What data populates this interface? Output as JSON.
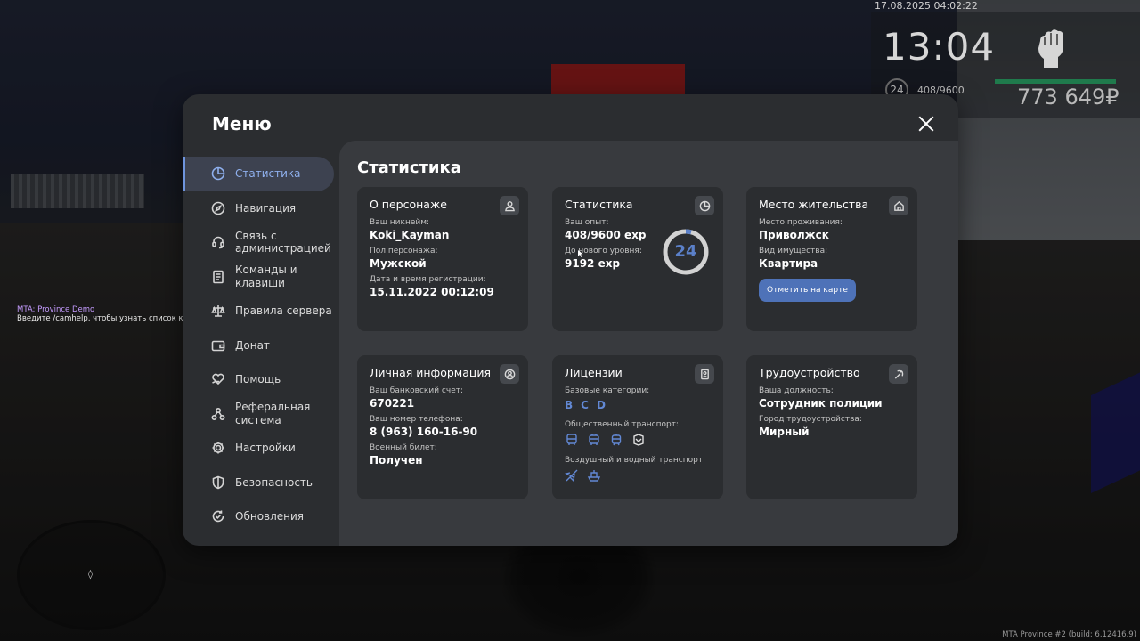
{
  "hud": {
    "datetime": "17.08.2025 04:02:22",
    "time": "13:04",
    "level": "24",
    "exp": "408/9600",
    "money": "773 649₽"
  },
  "chat": {
    "line1": "MTA: Province Demo",
    "line2": "Введите /camhelp, чтобы узнать список команд для работы с камерой."
  },
  "build_info": "MTA Province #2 (build: 6.12416.9)",
  "menu": {
    "title": "Меню",
    "sidebar": [
      {
        "label": "Статистика",
        "icon": "pie-chart-icon",
        "active": true
      },
      {
        "label": "Навигация",
        "icon": "compass-icon"
      },
      {
        "label": "Связь с администрацией",
        "icon": "headset-icon"
      },
      {
        "label": "Команды и клавиши",
        "icon": "document-icon"
      },
      {
        "label": "Правила сервера",
        "icon": "scales-icon"
      },
      {
        "label": "Донат",
        "icon": "wallet-icon"
      },
      {
        "label": "Помощь",
        "icon": "heart-hand-icon"
      },
      {
        "label": "Реферальная система",
        "icon": "network-icon"
      },
      {
        "label": "Настройки",
        "icon": "gear-icon"
      },
      {
        "label": "Безопасность",
        "icon": "shield-icon"
      },
      {
        "label": "Обновления",
        "icon": "refresh-icon"
      }
    ],
    "content_title": "Статистика",
    "cards": {
      "character": {
        "title": "О персонаже",
        "nickname_label": "Ваш никнейм:",
        "nickname": "Koki_Kayman",
        "gender_label": "Пол персонажа:",
        "gender": "Мужской",
        "reg_label": "Дата и время регистрации:",
        "reg": "15.11.2022 00:12:09"
      },
      "stats": {
        "title": "Статистика",
        "exp_label": "Ваш опыт:",
        "exp": "408/9600 exp",
        "next_label": "До нового уровня:",
        "next": "9192 exp",
        "level": "24",
        "progress": 0.0425
      },
      "residence": {
        "title": "Место жительства",
        "place_label": "Место проживания:",
        "place": "Приволжск",
        "property_label": "Вид имущества:",
        "property": "Квартира",
        "button": "Отметить на карте"
      },
      "personal": {
        "title": "Личная информация",
        "bank_label": "Ваш банковский счет:",
        "bank": "670221",
        "phone_label": "Ваш номер телефона:",
        "phone": "8 (963) 160-16-90",
        "military_label": "Военный билет:",
        "military": "Получен"
      },
      "licenses": {
        "title": "Лицензии",
        "base_label": "Базовые категории:",
        "base_categories": [
          "B",
          "C",
          "D"
        ],
        "public_label": "Общественный транспорт:",
        "air_label": "Воздушный и водный транспорт:"
      },
      "employment": {
        "title": "Трудоустройство",
        "position_label": "Ваша должность:",
        "position": "Сотрудник полиции",
        "city_label": "Город трудоустройства:",
        "city": "Мирный"
      }
    }
  },
  "colors": {
    "accent": "#6288d4",
    "active_item_bg": "#3d4250",
    "window_bg": "#2b2d30",
    "content_bg": "#383a3e",
    "button_bg": "#4e72b8"
  }
}
